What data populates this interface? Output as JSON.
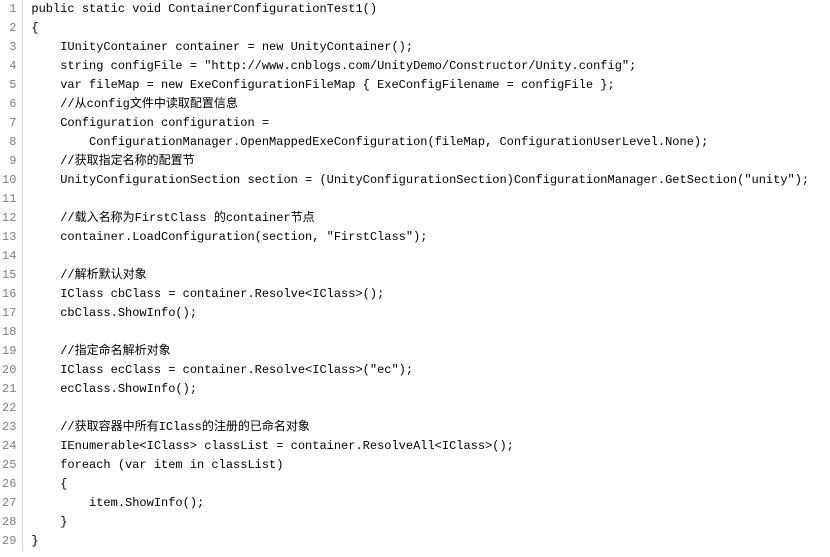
{
  "lines": [
    "public static void ContainerConfigurationTest1()",
    "{",
    "    IUnityContainer container = new UnityContainer();",
    "    string configFile = \"http://www.cnblogs.com/UnityDemo/Constructor/Unity.config\";",
    "    var fileMap = new ExeConfigurationFileMap { ExeConfigFilename = configFile };",
    "    //从config文件中读取配置信息",
    "    Configuration configuration =",
    "        ConfigurationManager.OpenMappedExeConfiguration(fileMap, ConfigurationUserLevel.None);",
    "    //获取指定名称的配置节",
    "    UnityConfigurationSection section = (UnityConfigurationSection)ConfigurationManager.GetSection(\"unity\");",
    "",
    "    //载入名称为FirstClass 的container节点",
    "    container.LoadConfiguration(section, \"FirstClass\");",
    "",
    "    //解析默认对象",
    "    IClass cbClass = container.Resolve<IClass>();",
    "    cbClass.ShowInfo();",
    "",
    "    //指定命名解析对象",
    "    IClass ecClass = container.Resolve<IClass>(\"ec\");",
    "    ecClass.ShowInfo();",
    "",
    "    //获取容器中所有IClass的注册的已命名对象",
    "    IEnumerable<IClass> classList = container.ResolveAll<IClass>();",
    "    foreach (var item in classList)",
    "    {",
    "        item.ShowInfo();",
    "    }",
    "}"
  ]
}
